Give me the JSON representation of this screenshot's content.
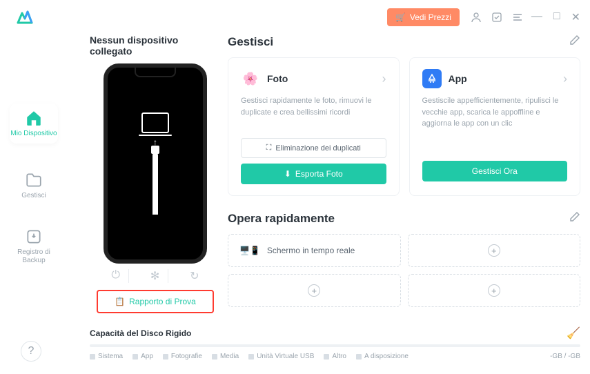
{
  "topbar": {
    "price_label": "Vedi Prezzi"
  },
  "sidebar": {
    "items": [
      {
        "label": "Mio Dispositivo"
      },
      {
        "label": "Gestisci"
      },
      {
        "label": "Registro di Backup"
      }
    ]
  },
  "device": {
    "title": "Nessun dispositivo collegato",
    "report_label": "Rapporto di Prova"
  },
  "manage": {
    "title": "Gestisci",
    "cards": [
      {
        "title": "Foto",
        "desc": "Gestisci rapidamente le foto, rimuovi le duplicate e crea bellissimi ricordi",
        "sub_btn": "Eliminazione dei duplicati",
        "main_btn": "Esporta Foto"
      },
      {
        "title": "App",
        "desc": "Gestiscile appefficientemente, ripulisci le vecchie app, scarica le appoffline e aggiorna le app con un clic",
        "main_btn": "Gestisci Ora"
      }
    ]
  },
  "quick": {
    "title": "Opera rapidamente",
    "items": [
      {
        "label": "Schermo in tempo reale"
      }
    ]
  },
  "capacity": {
    "title": "Capacità del Disco Rigido",
    "legend": [
      "Sistema",
      "App",
      "Fotografie",
      "Media",
      "Unità Virtuale USB",
      "Altro",
      "A disposizione"
    ],
    "value": "-GB / -GB"
  }
}
